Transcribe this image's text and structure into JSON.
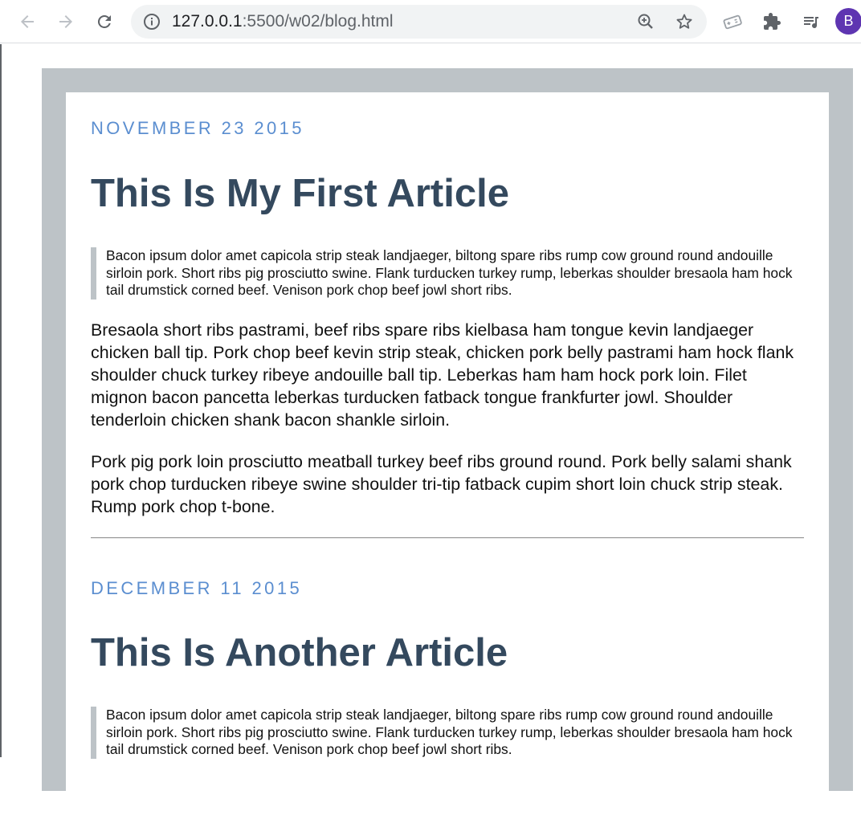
{
  "browser": {
    "url_host": "127.0.0.1",
    "url_rest": ":5500/w02/blog.html",
    "profile_initial": "B",
    "icons": [
      "back-arrow-icon",
      "forward-arrow-icon",
      "reload-icon",
      "info-icon",
      "zoom-icon",
      "star-icon",
      "tag-icon",
      "extensions-puzzle-icon",
      "media-queue-icon"
    ]
  },
  "articles": [
    {
      "date": "NOVEMBER 23 2015",
      "title": "This Is My First Article",
      "quote": "Bacon ipsum dolor amet capicola strip steak landjaeger, biltong spare ribs rump cow ground round andouille sirloin pork. Short ribs pig prosciutto swine. Flank turducken turkey rump, leberkas shoulder bresaola ham hock tail drumstick corned beef. Venison pork chop beef jowl short ribs.",
      "paragraphs": [
        "Bresaola short ribs pastrami, beef ribs spare ribs kielbasa ham tongue kevin landjaeger chicken ball tip. Pork chop beef kevin strip steak, chicken pork belly pastrami ham hock flank shoulder chuck turkey ribeye andouille ball tip. Leberkas ham ham hock pork loin. Filet mignon bacon pancetta leberkas turducken fatback tongue frankfurter jowl. Shoulder tenderloin chicken shank bacon shankle sirloin.",
        "Pork pig pork loin prosciutto meatball turkey beef ribs ground round. Pork belly salami shank pork chop turducken ribeye swine shoulder tri-tip fatback cupim short loin chuck strip steak. Rump pork chop t-bone."
      ]
    },
    {
      "date": "DECEMBER 11 2015",
      "title": "This Is Another Article",
      "quote": "Bacon ipsum dolor amet capicola strip steak landjaeger, biltong spare ribs rump cow ground round andouille sirloin pork. Short ribs pig prosciutto swine. Flank turducken turkey rump, leberkas shoulder bresaola ham hock tail drumstick corned beef. Venison pork chop beef jowl short ribs."
    }
  ],
  "colors": {
    "frame": "#bdc3c7",
    "date": "#5b8ed0",
    "title": "#34495e",
    "avatar": "#5e35b1"
  }
}
